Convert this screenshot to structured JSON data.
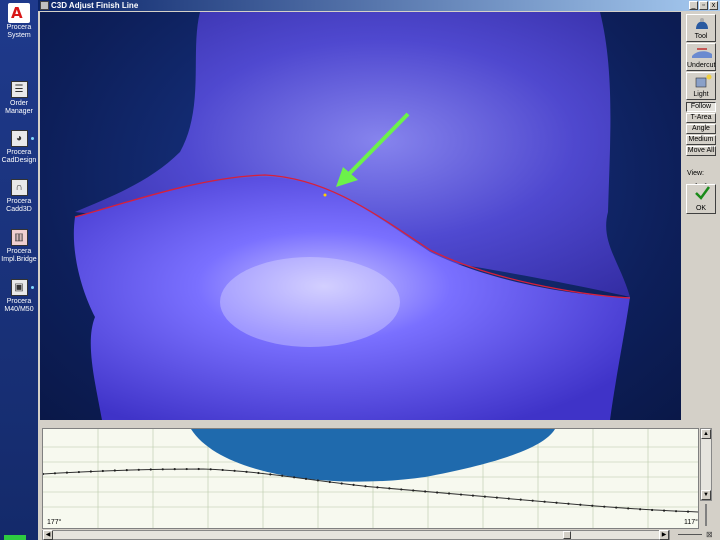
{
  "window": {
    "title": "C3D Adjust Finish Line",
    "controls": {
      "minimize": "_",
      "restore": "▫",
      "close": "x"
    }
  },
  "sidebar": {
    "logo_glyph": "A",
    "items": [
      {
        "label_line1": "Procera",
        "label_line2": "System",
        "icon": "procera-logo-icon"
      },
      {
        "label_line1": "Order",
        "label_line2": "Manager",
        "icon": "order-manager-icon"
      },
      {
        "label_line1": "Procera",
        "label_line2": "CadDesign",
        "icon": "cad-design-icon"
      },
      {
        "label_line1": "Procera",
        "label_line2": "Cadd3D",
        "icon": "cadd3d-icon"
      },
      {
        "label_line1": "Procera",
        "label_line2": "Impl.Bridge",
        "icon": "impl-bridge-icon"
      },
      {
        "label_line1": "Procera",
        "label_line2": "M40/M50",
        "icon": "m40-m50-icon"
      }
    ]
  },
  "toolbar": {
    "tool_label": "Tool",
    "undercut_label": "Undercut",
    "light_label": "Light",
    "follow_label": "Follow",
    "tarea_label": "T-Area",
    "angle_label": "Angle",
    "medium_label": "Medium",
    "moveall_label": "Move All",
    "view_label": "View:",
    "ok_label": "OK"
  },
  "profile": {
    "left_angle": "177°",
    "right_angle": "117°"
  },
  "colors": {
    "model": "#5a4ee0",
    "finish_line": "#d8203a",
    "arrow": "#6cf24a",
    "viewport_bg": "#0d1f5a"
  }
}
